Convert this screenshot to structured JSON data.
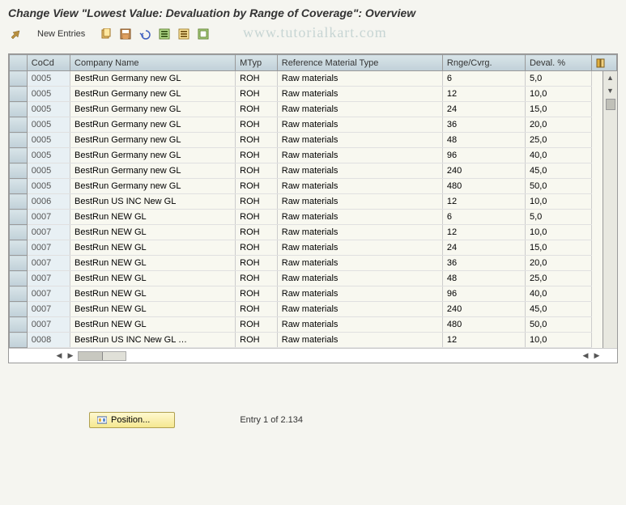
{
  "title": "Change View \"Lowest Value: Devaluation by Range of Coverage\": Overview",
  "watermark": "www.tutorialkart.com",
  "toolbar": {
    "new_entries_label": "New Entries"
  },
  "columns": {
    "cocd": "CoCd",
    "company": "Company Name",
    "mtyp": "MTyp",
    "refmat": "Reference Material Type",
    "range": "Rnge/Cvrg.",
    "deval": "Deval. %"
  },
  "rows": [
    {
      "cocd": "0005",
      "company": "BestRun Germany new GL",
      "mtyp": "ROH",
      "refmat": "Raw materials",
      "range": "6",
      "deval": "5,0"
    },
    {
      "cocd": "0005",
      "company": "BestRun Germany new GL",
      "mtyp": "ROH",
      "refmat": "Raw materials",
      "range": "12",
      "deval": "10,0"
    },
    {
      "cocd": "0005",
      "company": "BestRun Germany new GL",
      "mtyp": "ROH",
      "refmat": "Raw materials",
      "range": "24",
      "deval": "15,0"
    },
    {
      "cocd": "0005",
      "company": "BestRun Germany new GL",
      "mtyp": "ROH",
      "refmat": "Raw materials",
      "range": "36",
      "deval": "20,0"
    },
    {
      "cocd": "0005",
      "company": "BestRun Germany new GL",
      "mtyp": "ROH",
      "refmat": "Raw materials",
      "range": "48",
      "deval": "25,0"
    },
    {
      "cocd": "0005",
      "company": "BestRun Germany new GL",
      "mtyp": "ROH",
      "refmat": "Raw materials",
      "range": "96",
      "deval": "40,0"
    },
    {
      "cocd": "0005",
      "company": "BestRun Germany new GL",
      "mtyp": "ROH",
      "refmat": "Raw materials",
      "range": "240",
      "deval": "45,0"
    },
    {
      "cocd": "0005",
      "company": "BestRun Germany new GL",
      "mtyp": "ROH",
      "refmat": "Raw materials",
      "range": "480",
      "deval": "50,0"
    },
    {
      "cocd": "0006",
      "company": "BestRun US INC New GL",
      "mtyp": "ROH",
      "refmat": "Raw materials",
      "range": "12",
      "deval": "10,0"
    },
    {
      "cocd": "0007",
      "company": "BestRun NEW GL",
      "mtyp": "ROH",
      "refmat": "Raw materials",
      "range": "6",
      "deval": "5,0"
    },
    {
      "cocd": "0007",
      "company": "BestRun NEW GL",
      "mtyp": "ROH",
      "refmat": "Raw materials",
      "range": "12",
      "deval": "10,0"
    },
    {
      "cocd": "0007",
      "company": "BestRun NEW GL",
      "mtyp": "ROH",
      "refmat": "Raw materials",
      "range": "24",
      "deval": "15,0"
    },
    {
      "cocd": "0007",
      "company": "BestRun NEW GL",
      "mtyp": "ROH",
      "refmat": "Raw materials",
      "range": "36",
      "deval": "20,0"
    },
    {
      "cocd": "0007",
      "company": "BestRun NEW GL",
      "mtyp": "ROH",
      "refmat": "Raw materials",
      "range": "48",
      "deval": "25,0"
    },
    {
      "cocd": "0007",
      "company": "BestRun NEW GL",
      "mtyp": "ROH",
      "refmat": "Raw materials",
      "range": "96",
      "deval": "40,0"
    },
    {
      "cocd": "0007",
      "company": "BestRun NEW GL",
      "mtyp": "ROH",
      "refmat": "Raw materials",
      "range": "240",
      "deval": "45,0"
    },
    {
      "cocd": "0007",
      "company": "BestRun NEW GL",
      "mtyp": "ROH",
      "refmat": "Raw materials",
      "range": "480",
      "deval": "50,0"
    },
    {
      "cocd": "0008",
      "company": "BestRun US INC New GL …",
      "mtyp": "ROH",
      "refmat": "Raw materials",
      "range": "12",
      "deval": "10,0"
    }
  ],
  "footer": {
    "position_label": "Position...",
    "entry_status": "Entry 1 of 2.134"
  }
}
